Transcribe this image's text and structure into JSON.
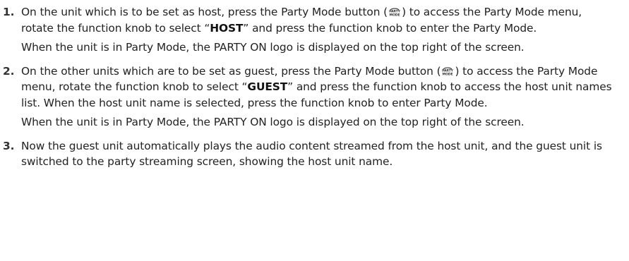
{
  "steps": [
    {
      "number": "1.",
      "p1_a": "On the unit which is to be set as host, press the Party Mode button (",
      "p1_b": ") to access the Party Mode menu, rotate the function knob to select “",
      "p1_bold": "HOST",
      "p1_c": "” and press the function knob to enter the Party Mode.",
      "p2": "When the unit is in Party Mode, the PARTY ON logo is displayed on the top right of the screen."
    },
    {
      "number": "2.",
      "p1_a": "On the other units which are to be set as guest, press the Party Mode button (",
      "p1_b": ") to access the Party Mode menu, rotate the function knob to select “",
      "p1_bold": "GUEST",
      "p1_c": "” and press the function knob to access the host unit names list. When the host unit name is selected, press the function knob to enter Party Mode.",
      "p2": "When the unit is in Party Mode, the PARTY ON logo is displayed on the top right of the screen."
    },
    {
      "number": "3.",
      "p1": "Now the guest unit automatically plays the audio content streamed from the host unit, and the guest unit is switched to the party streaming screen, showing the host unit name."
    }
  ],
  "icon": {
    "name": "party-mode-icon",
    "line1": "PARTY",
    "line2": "MODE"
  }
}
